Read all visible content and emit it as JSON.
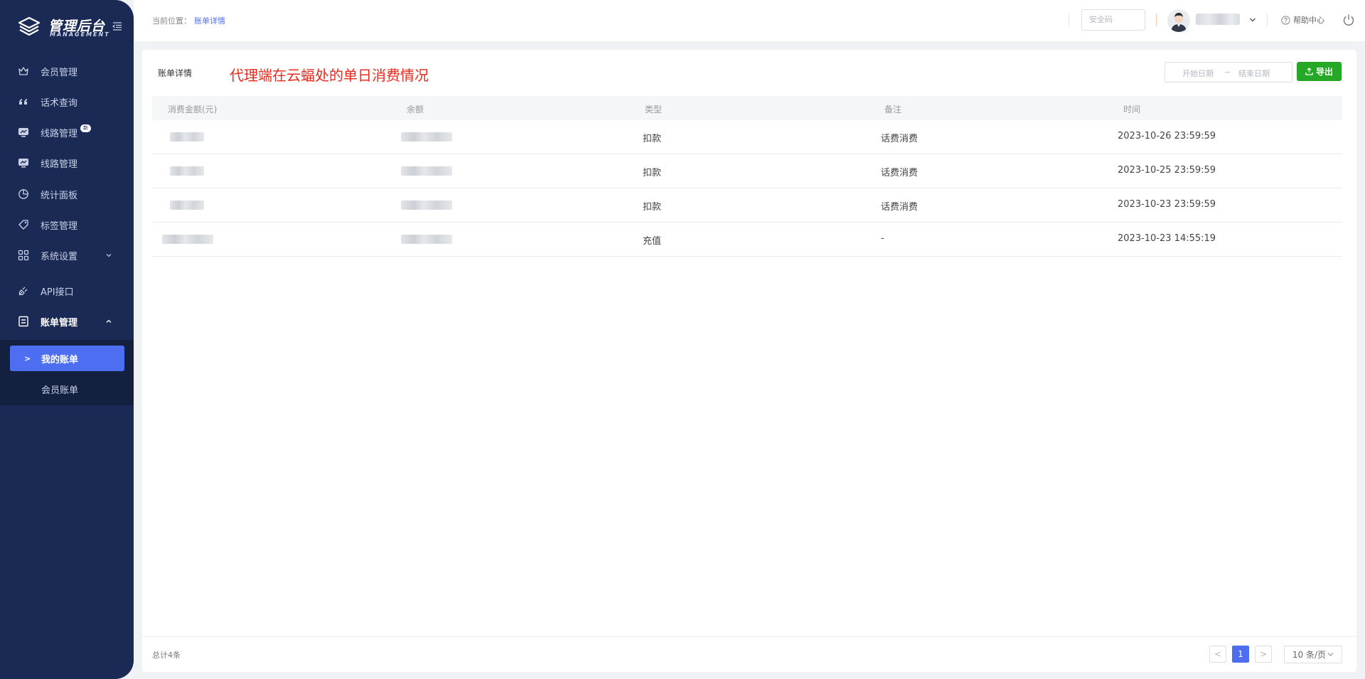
{
  "brand": {
    "title": "管理后台",
    "subtitle": "MANAGEMENT"
  },
  "sidebar": {
    "items": [
      {
        "label": "会员管理",
        "icon": "crown-icon"
      },
      {
        "label": "话术查询",
        "icon": "quote-icon"
      },
      {
        "label": "线路管理",
        "icon": "route-icon",
        "badge": "新"
      },
      {
        "label": "线路管理",
        "icon": "route-icon"
      },
      {
        "label": "统计面板",
        "icon": "pie-chart-icon"
      },
      {
        "label": "标签管理",
        "icon": "tag-icon"
      },
      {
        "label": "系统设置",
        "icon": "grid-icon"
      },
      {
        "label": "API接口",
        "icon": "plug-icon"
      },
      {
        "label": "账单管理",
        "icon": "bill-icon"
      }
    ],
    "submenu": [
      {
        "label": "我的账单"
      },
      {
        "label": "会员账单"
      }
    ]
  },
  "header": {
    "crumb_prefix": "当前位置：",
    "crumb_current": "账单详情",
    "security_placeholder": "安全码",
    "help_label": "帮助中心"
  },
  "card": {
    "title": "账单详情",
    "annotation": "代理端在云蝠处的单日消费情况",
    "date_start_placeholder": "开始日期",
    "date_sep": "~",
    "date_end_placeholder": "结束日期",
    "export_label": "导出"
  },
  "table": {
    "columns": [
      "消费金额(元)",
      "余额",
      "类型",
      "备注",
      "时间"
    ],
    "rows": [
      {
        "type": "扣款",
        "note": "话费消费",
        "time": "2023-10-26 23:59:59"
      },
      {
        "type": "扣款",
        "note": "话费消费",
        "time": "2023-10-25 23:59:59"
      },
      {
        "type": "扣款",
        "note": "话费消费",
        "time": "2023-10-23 23:59:59"
      },
      {
        "type": "充值",
        "note": "-",
        "time": "2023-10-23 14:55:19"
      }
    ]
  },
  "pagination": {
    "total": "总计4条",
    "current_page": "1",
    "prev": "<",
    "next": ">",
    "page_size": "10 条/页"
  },
  "colors": {
    "sidebar_bg": "#1a2a55",
    "accent": "#4e6ef2",
    "export": "#25a825",
    "annotation": "#e8291c"
  }
}
